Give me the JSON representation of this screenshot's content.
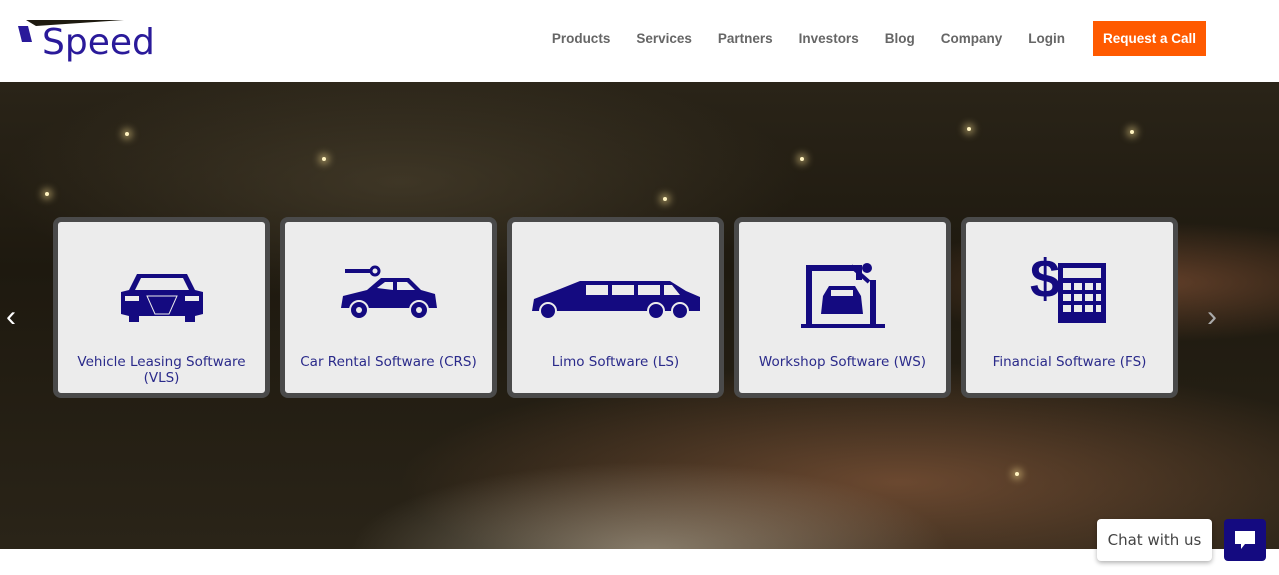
{
  "brand": {
    "name": "Speed"
  },
  "nav": {
    "items": [
      "Products",
      "Services",
      "Partners",
      "Investors",
      "Blog",
      "Company",
      "Login"
    ],
    "cta": "Request a Call"
  },
  "products": [
    {
      "label": "Vehicle Leasing Software (VLS)",
      "icon": "car-front-icon"
    },
    {
      "label": "Car Rental Software (CRS)",
      "icon": "car-key-icon"
    },
    {
      "label": "Limo Software (LS)",
      "icon": "limousine-icon"
    },
    {
      "label": "Workshop Software (WS)",
      "icon": "car-repair-icon"
    },
    {
      "label": "Financial Software (FS)",
      "icon": "calculator-dollar-icon"
    }
  ],
  "chat": {
    "label": "Chat with us"
  },
  "colors": {
    "brand": "#2a1a9a",
    "cta": "#ff5a00",
    "icon": "#140a80"
  }
}
